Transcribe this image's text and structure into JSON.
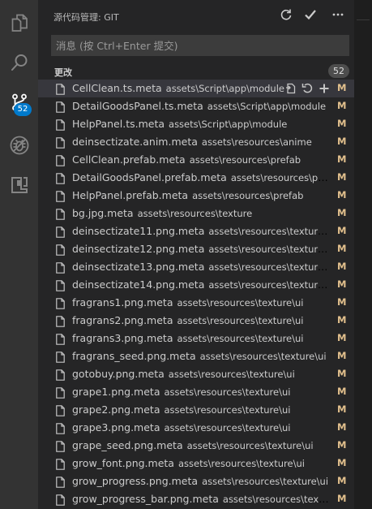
{
  "activity_bar": {
    "items": [
      {
        "icon": "files-icon"
      },
      {
        "icon": "search-icon"
      },
      {
        "icon": "source-control-icon",
        "badge": "52"
      },
      {
        "icon": "debug-icon"
      },
      {
        "icon": "extensions-icon"
      }
    ]
  },
  "header": {
    "title": "源代码管理: GIT",
    "actions": [
      "refresh-icon",
      "commit-check-icon",
      "more-icon"
    ]
  },
  "commit": {
    "placeholder": "消息 (按 Ctrl+Enter 提交)"
  },
  "changes": {
    "label": "更改",
    "count": "52",
    "row_actions": [
      "open-file-icon",
      "discard-icon",
      "stage-icon"
    ],
    "items": [
      {
        "name": "CellClean.ts.meta",
        "path": "assets\\Script\\app\\module",
        "status": "M"
      },
      {
        "name": "DetailGoodsPanel.ts.meta",
        "path": "assets\\Script\\app\\module",
        "status": "M"
      },
      {
        "name": "HelpPanel.ts.meta",
        "path": "assets\\Script\\app\\module",
        "status": "M"
      },
      {
        "name": "deinsectizate.anim.meta",
        "path": "assets\\resources\\anime",
        "status": "M"
      },
      {
        "name": "CellClean.prefab.meta",
        "path": "assets\\resources\\prefab",
        "status": "M"
      },
      {
        "name": "DetailGoodsPanel.prefab.meta",
        "path": "assets\\resources\\prefab",
        "status": "M"
      },
      {
        "name": "HelpPanel.prefab.meta",
        "path": "assets\\resources\\prefab",
        "status": "M"
      },
      {
        "name": "bg.jpg.meta",
        "path": "assets\\resources\\texture",
        "status": "M"
      },
      {
        "name": "deinsectizate11.png.meta",
        "path": "assets\\resources\\texture\\effect...",
        "status": "M"
      },
      {
        "name": "deinsectizate12.png.meta",
        "path": "assets\\resources\\texture\\effect...",
        "status": "M"
      },
      {
        "name": "deinsectizate13.png.meta",
        "path": "assets\\resources\\texture\\effect...",
        "status": "M"
      },
      {
        "name": "deinsectizate14.png.meta",
        "path": "assets\\resources\\texture\\effect...",
        "status": "M"
      },
      {
        "name": "fragrans1.png.meta",
        "path": "assets\\resources\\texture\\ui",
        "status": "M"
      },
      {
        "name": "fragrans2.png.meta",
        "path": "assets\\resources\\texture\\ui",
        "status": "M"
      },
      {
        "name": "fragrans3.png.meta",
        "path": "assets\\resources\\texture\\ui",
        "status": "M"
      },
      {
        "name": "fragrans_seed.png.meta",
        "path": "assets\\resources\\texture\\ui",
        "status": "M"
      },
      {
        "name": "gotobuy.png.meta",
        "path": "assets\\resources\\texture\\ui",
        "status": "M"
      },
      {
        "name": "grape1.png.meta",
        "path": "assets\\resources\\texture\\ui",
        "status": "M"
      },
      {
        "name": "grape2.png.meta",
        "path": "assets\\resources\\texture\\ui",
        "status": "M"
      },
      {
        "name": "grape3.png.meta",
        "path": "assets\\resources\\texture\\ui",
        "status": "M"
      },
      {
        "name": "grape_seed.png.meta",
        "path": "assets\\resources\\texture\\ui",
        "status": "M"
      },
      {
        "name": "grow_font.png.meta",
        "path": "assets\\resources\\texture\\ui",
        "status": "M"
      },
      {
        "name": "grow_progress.png.meta",
        "path": "assets\\resources\\texture\\ui",
        "status": "M"
      },
      {
        "name": "grow_progress_bar.png.meta",
        "path": "assets\\resources\\texture\\ui",
        "status": "M"
      }
    ]
  },
  "colors": {
    "activity_bg": "#333333",
    "sidebar_bg": "#252526",
    "accent": "#007acc",
    "modified": "#e2c08d",
    "selection": "#37373d"
  }
}
